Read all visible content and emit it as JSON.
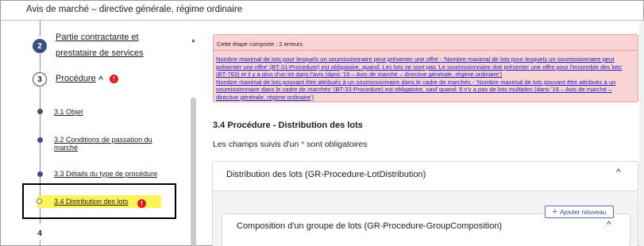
{
  "page_title": "Avis de marché – directive générale, régime ordinaire",
  "sidebar": {
    "steps": [
      {
        "number": "2",
        "label_line1": "Partie contractante et",
        "label_line2": "prestataire de services"
      },
      {
        "number": "3",
        "label": "Procédure",
        "chevron": "^",
        "error": "!"
      },
      {
        "number": "4"
      }
    ],
    "subitems": [
      {
        "label": "3.1 Objet"
      },
      {
        "label_line1": "3.2 Conditions de passation du",
        "label_line2": "marché"
      },
      {
        "label": "3.3 Détails du type de procédure"
      },
      {
        "label": "3.4 Distribution des lots",
        "error": "!"
      }
    ],
    "scroll_up": "▲"
  },
  "main": {
    "errors": {
      "heading": "Cette étape comporte : 2 erreurs",
      "items": [
        "Nombre maximal de lots pour lesquels un soumissionnaire peut présenter une offre - 'Nombre maximal de lots pour lesquels un soumissionnaire peut présenter une offre' (BT-31-Procedure) est obligatoire, quand: Les lots ne sont pas 'Le soumissionnaire doit présenter une offre pour l'ensemble des lots' (BT-763) et il y a plus d'un lot dans l'avis (dans '16 – Avis de marché – directive générale, régime ordinaire')",
        "Nombre maximal de lots pouvant être attribués à un soumissionnaire dans le cadre de marchés - 'Nombre maximal de lots pouvant être attribués à un soumissionnaire dans le cadre de marchés' (BT-33-Procedure) est obligatoire, sauf quand: Il n'y a pas de lots multiples (dans '16 – Avis de marché – directive générale, régime ordinaire')"
      ]
    },
    "section_title": "3.4 Procédure - Distribution des lots",
    "required_note_prefix": "Les champs suivis d'un ",
    "required_star": "*",
    "required_note_suffix": " sont obligatoires",
    "card": {
      "title": "Distribution des lots (GR-Procedure-LotDistribution)",
      "chevron": "^",
      "add_button": "Ajouter nouveau",
      "add_icon": "+",
      "inner_card": {
        "title": "Composition d'un groupe de lots (GR-Procedure-GroupComposition)",
        "chevron": "^"
      }
    }
  },
  "colors": {
    "step_fill": "#3b4f7c",
    "error_red": "#e11b1b",
    "error_bg": "#f8d4d4",
    "link_blue": "#1f1cc7",
    "highlight_yellow": "#fff35a"
  }
}
